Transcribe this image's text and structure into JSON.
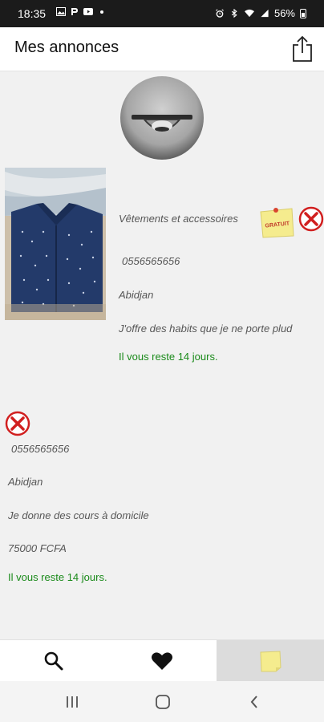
{
  "status_bar": {
    "time": "18:35",
    "battery": "56%",
    "icons_left": [
      "image-icon",
      "p-icon",
      "youtube-icon",
      "dot-icon"
    ],
    "icons_right": [
      "alarm-icon",
      "bluetooth-icon",
      "wifi-icon",
      "signal-icon",
      "battery-icon"
    ]
  },
  "header": {
    "title": "Mes annonces",
    "share_icon": "share-icon"
  },
  "profile": {
    "avatar": "ceiling-light-photo"
  },
  "listings": [
    {
      "category": "Vêtements et accessoires",
      "badge": "GRATUIT",
      "phone": "0556565656",
      "city": "Abidjan",
      "description": "J'offre des habits que je ne porte plud",
      "remaining": "Il vous reste 14 jours.",
      "image": "blue-shirt-photo"
    },
    {
      "phone": "0556565656",
      "city": "Abidjan",
      "description": "Je donne des cours à domicile",
      "price": "75000 FCFA",
      "remaining": "Il vous reste 14 jours."
    }
  ],
  "bottom_nav": {
    "items": [
      {
        "icon": "search-icon",
        "active": false
      },
      {
        "icon": "heart-icon",
        "active": false
      },
      {
        "icon": "sticky-note-icon",
        "active": true
      }
    ]
  },
  "colors": {
    "accent_green": "#1a8a1a",
    "delete_red": "#d11f1f",
    "note_yellow": "#f5ec8e"
  }
}
